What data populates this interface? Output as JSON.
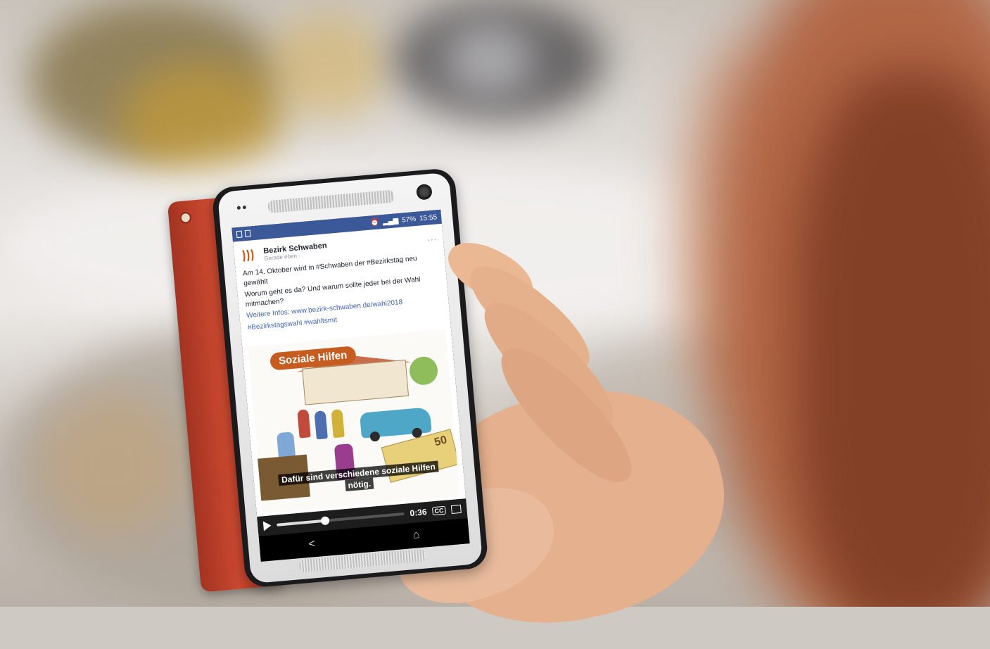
{
  "status_bar": {
    "battery": "57%",
    "time": "15:55"
  },
  "post": {
    "page_name": "Bezirk Schwaben",
    "meta": "Gerade eben · ",
    "lines": [
      "Am 14. Oktober wird in #Schwaben der #Bezirkstag neu gewählt",
      "Worum geht es da? Und warum sollte jeder bei der Wahl mitmachen?",
      "Weitere Infos: www.bezirk-schwaben.de/wahl2018",
      "#Bezirkstagswahl #wahltsmit"
    ]
  },
  "video": {
    "title_badge": "Soziale Hilfen",
    "money_value": "50",
    "subtitle_line1": "Dafür sind verschiedene soziale Hilfen",
    "subtitle_line2": "nötig.",
    "time": "0:36",
    "progress_fraction": 0.38
  },
  "nav": {
    "back": "<",
    "home": "⌂"
  }
}
